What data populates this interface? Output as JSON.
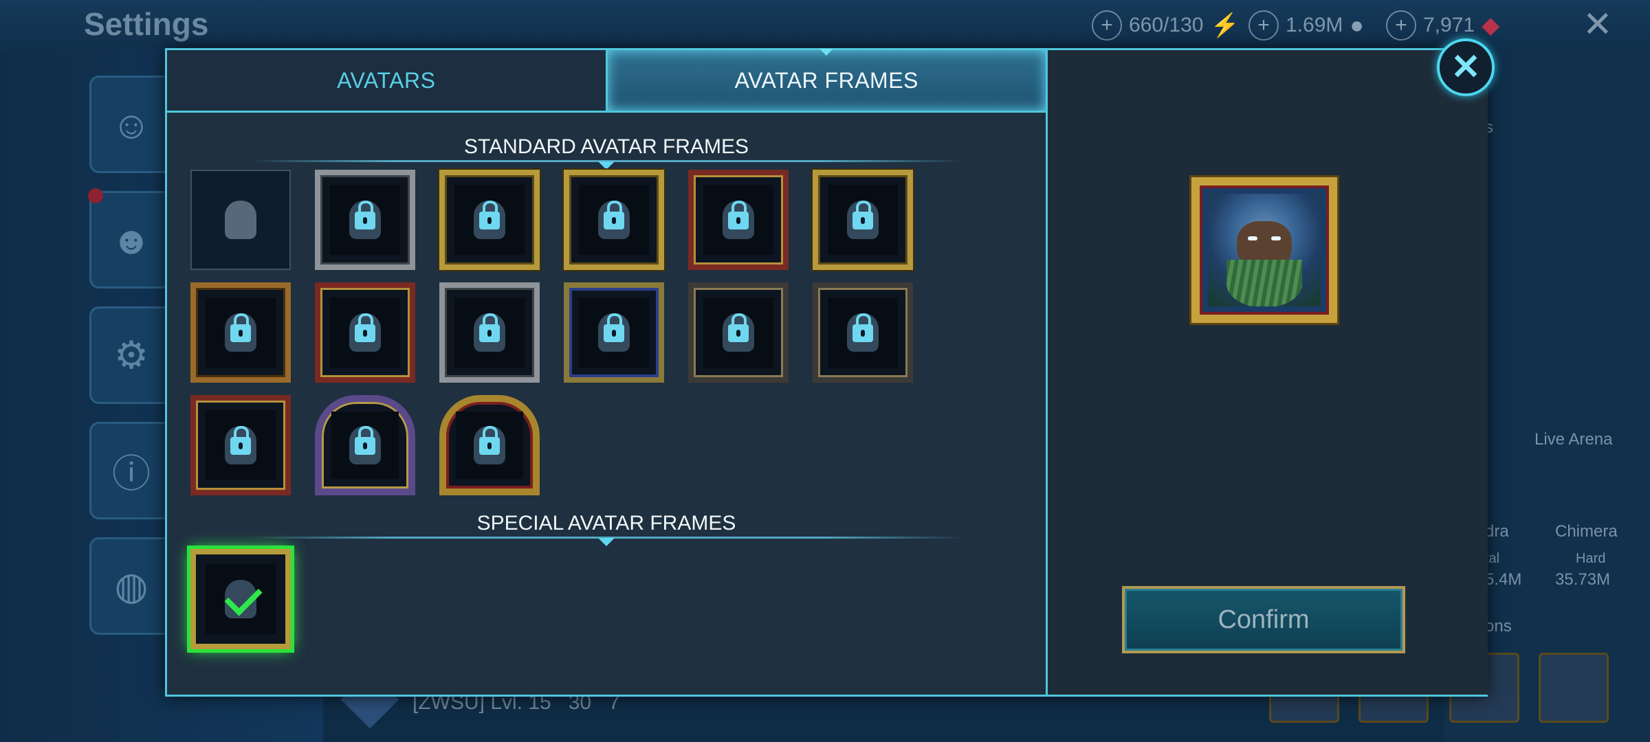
{
  "background": {
    "title": "Settings",
    "resources": [
      {
        "value": "660/130",
        "icon": "energy-icon"
      },
      {
        "value": "1.69M",
        "icon": "silver-icon"
      },
      {
        "value": "7,971",
        "icon": "gem-icon"
      }
    ],
    "right_panel": {
      "live_arena": "Live Arena",
      "hydra_label": "dra",
      "chimera_label": "Chimera",
      "hydra_sub": "tal",
      "chimera_sub": "Hard",
      "hydra_value": "5.4M",
      "chimera_value": "35.73M",
      "clan_label": "s",
      "champions_label": "ons"
    },
    "player_bar": {
      "clan_level": "[ZWSU] Lvl. 15",
      "stat_a": "30",
      "stat_b": "7"
    }
  },
  "modal": {
    "tabs": [
      {
        "label": "AVATARS",
        "active": false
      },
      {
        "label": "AVATAR FRAMES",
        "active": true
      }
    ],
    "standard_section_title": "STANDARD AVATAR FRAMES",
    "special_section_title": "SPECIAL AVATAR FRAMES",
    "standard_frames": [
      {
        "style": "plain",
        "locked": false
      },
      {
        "style": "silver",
        "locked": true
      },
      {
        "style": "gold",
        "locked": true
      },
      {
        "style": "gold",
        "locked": true
      },
      {
        "style": "red",
        "locked": true
      },
      {
        "style": "gold",
        "locked": true
      },
      {
        "style": "bronze",
        "locked": true
      },
      {
        "style": "red",
        "locked": true
      },
      {
        "style": "silver",
        "locked": true
      },
      {
        "style": "blue",
        "locked": true
      },
      {
        "style": "dark",
        "locked": true
      },
      {
        "style": "dark",
        "locked": true
      },
      {
        "style": "red",
        "locked": true
      },
      {
        "style": "purple",
        "locked": true
      },
      {
        "style": "arch",
        "locked": true
      }
    ],
    "special_frames": [
      {
        "style": "gold",
        "selected": true
      }
    ],
    "confirm_label": "Confirm",
    "close_icon": "close-icon",
    "accent_color": "#4fc7dd",
    "selection_color": "#2ee84a"
  }
}
